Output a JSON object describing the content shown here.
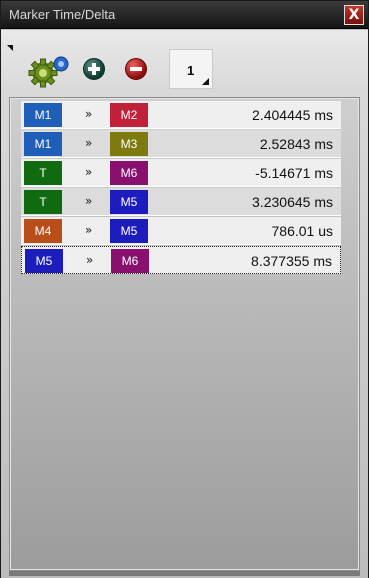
{
  "window": {
    "title": "Marker Time/Delta",
    "close_label": "X"
  },
  "toolbar": {
    "settings_icon": "gear-icon",
    "add_icon": "plus-circle-icon",
    "remove_icon": "minus-circle-icon",
    "count_value": "1"
  },
  "colors": {
    "M1": "#1f5fb8",
    "M2": "#c0203a",
    "M3": "#7d7a10",
    "M4": "#b84e1a",
    "M5": "#1d1dbd",
    "M6": "#8a1070",
    "T": "#0f6a10"
  },
  "rows": [
    {
      "from": "M1",
      "sep": "»",
      "to": "M2",
      "value": "2.404445 ms"
    },
    {
      "from": "M1",
      "sep": "»",
      "to": "M3",
      "value": "2.52843 ms"
    },
    {
      "from": "T",
      "sep": "»",
      "to": "M6",
      "value": "-5.14671 ms"
    },
    {
      "from": "T",
      "sep": "»",
      "to": "M5",
      "value": "3.230645 ms"
    },
    {
      "from": "M4",
      "sep": "»",
      "to": "M5",
      "value": "786.01 us"
    },
    {
      "from": "M5",
      "sep": "»",
      "to": "M6",
      "value": "8.377355 ms"
    }
  ]
}
